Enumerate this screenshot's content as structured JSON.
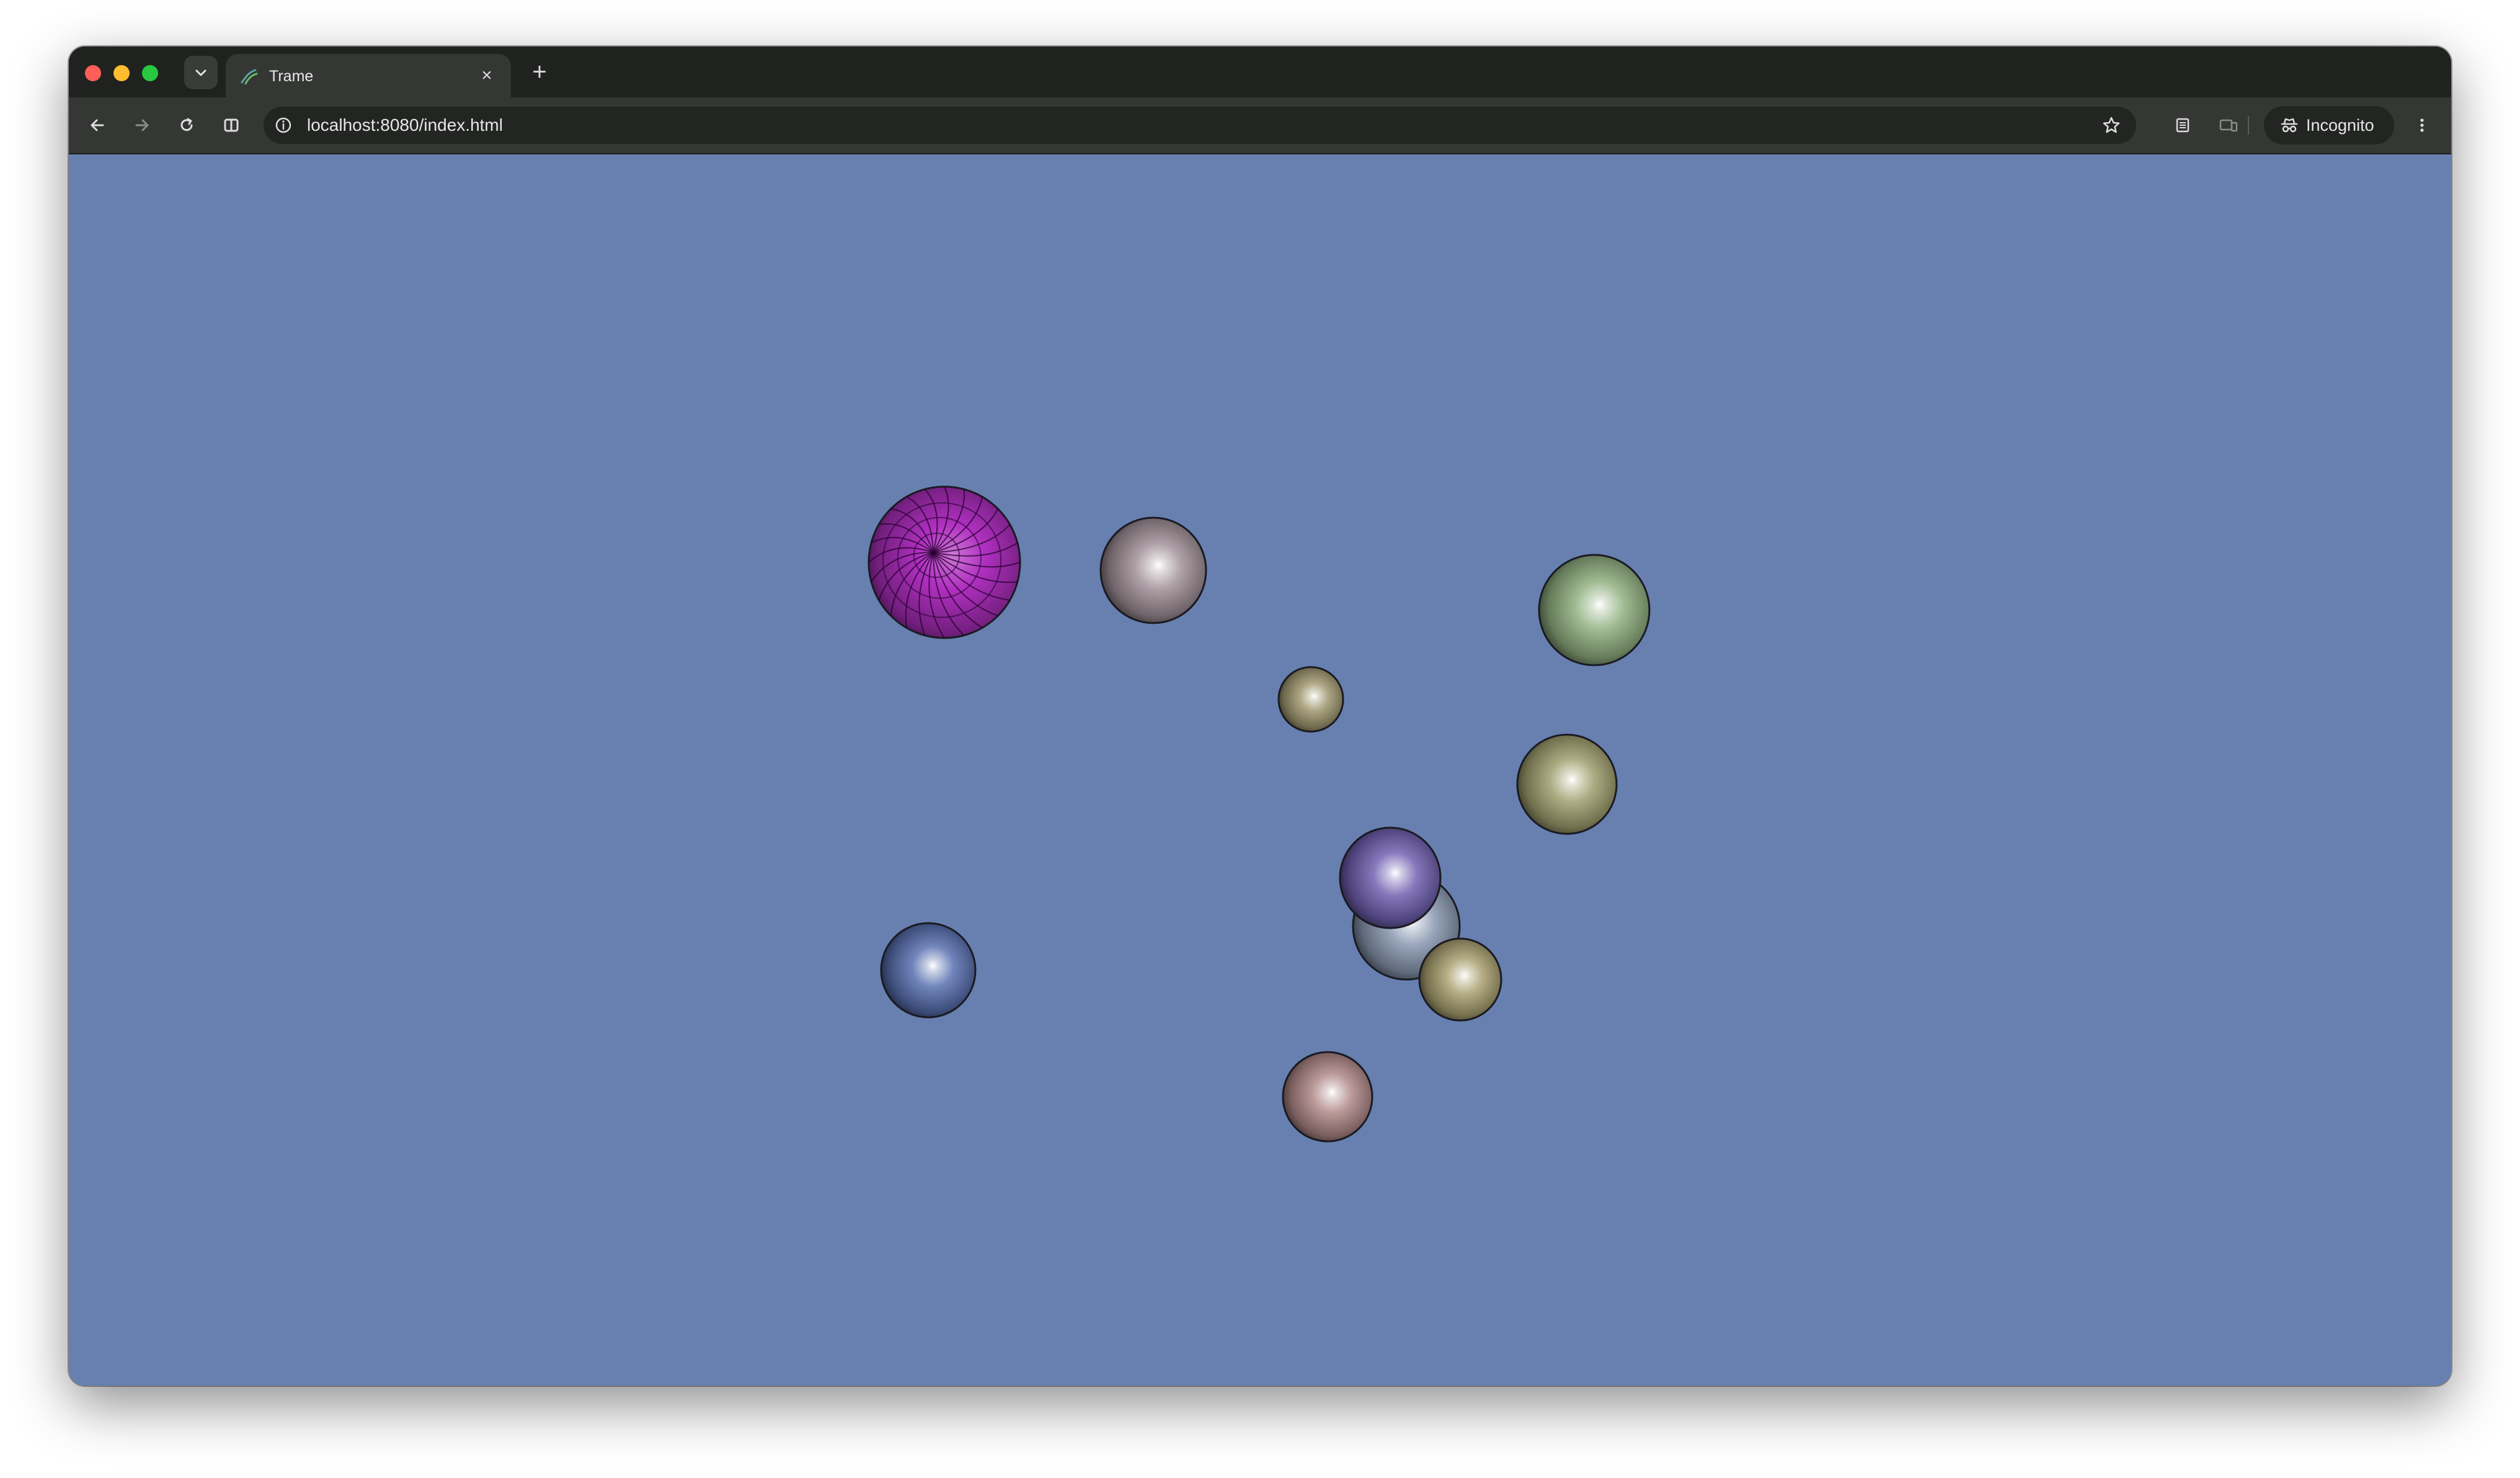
{
  "window": {
    "traffic_lights": [
      "#fe5f57",
      "#febc2e",
      "#28c840"
    ]
  },
  "tab": {
    "title": "Trame",
    "close_glyph": "×",
    "icon": "trame-logo-icon"
  },
  "new_tab_glyph": "+",
  "toolbar": {
    "back_icon": "back-arrow-icon",
    "forward_icon": "forward-arrow-icon",
    "reload_icon": "reload-icon",
    "split_icon": "split-view-icon"
  },
  "address_bar": {
    "url": "localhost:8080/index.html",
    "info_icon": "info-icon",
    "bookmark_icon": "star-icon"
  },
  "profile": {
    "label": "Incognito",
    "icon": "incognito-icon"
  },
  "render_view": {
    "background": "#6780b0",
    "spheres": [
      {
        "name": "magenta-wireframe-sphere",
        "color": "#b030c0",
        "wireframe": true
      },
      {
        "name": "gray-pink-sphere",
        "color": "#a09098"
      },
      {
        "name": "green-sphere",
        "color": "#90b080"
      },
      {
        "name": "small-khaki-sphere",
        "color": "#a09870"
      },
      {
        "name": "olive-sphere",
        "color": "#a0a070"
      },
      {
        "name": "purple-sphere",
        "color": "#7060b0"
      },
      {
        "name": "slate-sphere",
        "color": "#8898b0"
      },
      {
        "name": "yellow-olive-sphere",
        "color": "#a8a070"
      },
      {
        "name": "blue-sphere",
        "color": "#5870b0"
      },
      {
        "name": "rose-sphere",
        "color": "#b08888"
      }
    ]
  }
}
